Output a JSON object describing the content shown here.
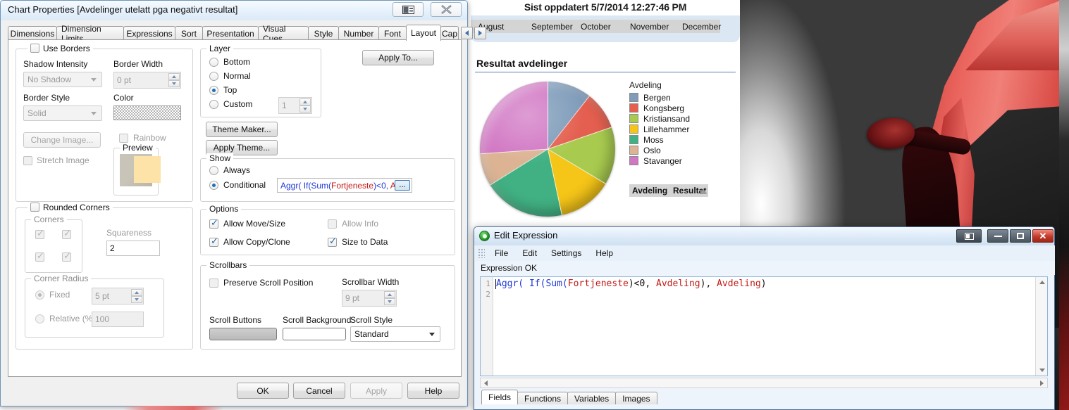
{
  "chart_properties": {
    "title": "Chart Properties [Avdelinger utelatt pga negativt resultat]",
    "titlebar_buttons": {
      "restore_label": "❐",
      "close_label": "✕"
    },
    "tabs": [
      {
        "label": "Dimensions",
        "active": false
      },
      {
        "label": "Dimension Limits",
        "active": false
      },
      {
        "label": "Expressions",
        "active": false
      },
      {
        "label": "Sort",
        "active": false
      },
      {
        "label": "Presentation",
        "active": false
      },
      {
        "label": "Visual Cues",
        "active": false
      },
      {
        "label": "Style",
        "active": false
      },
      {
        "label": "Number",
        "active": false
      },
      {
        "label": "Font",
        "active": false
      },
      {
        "label": "Layout",
        "active": true
      },
      {
        "label": "Cap",
        "active": false
      }
    ],
    "borders_group": {
      "title": "Use Borders",
      "checked": false,
      "shadow_intensity_label": "Shadow Intensity",
      "shadow_intensity_value": "No Shadow",
      "border_width_label": "Border Width",
      "border_width_value": "0 pt",
      "border_style_label": "Border Style",
      "border_style_value": "Solid",
      "color_label": "Color",
      "rainbow_label": "Rainbow",
      "rainbow_checked": false,
      "change_image_label": "Change Image...",
      "stretch_image_label": "Stretch Image",
      "stretch_image_checked": false,
      "preview_label": "Preview"
    },
    "rounded_group": {
      "title": "Rounded Corners",
      "checked": false,
      "corners_label": "Corners",
      "corners_checked": [
        true,
        true,
        true,
        true
      ],
      "squareness_label": "Squareness",
      "squareness_value": "2",
      "corner_radius_label": "Corner Radius",
      "fixed_label": "Fixed",
      "fixed_selected": true,
      "fixed_value": "5 pt",
      "relative_label": "Relative (%)",
      "relative_selected": false,
      "relative_value": "100"
    },
    "layer_group": {
      "title": "Layer",
      "options": [
        {
          "label": "Bottom",
          "selected": false
        },
        {
          "label": "Normal",
          "selected": false
        },
        {
          "label": "Top",
          "selected": true
        },
        {
          "label": "Custom",
          "selected": false
        }
      ],
      "custom_value": "1"
    },
    "apply_to_label": "Apply To...",
    "theme_maker_label": "Theme Maker...",
    "apply_theme_label": "Apply Theme...",
    "show_group": {
      "title": "Show",
      "always_label": "Always",
      "always_selected": false,
      "conditional_label": "Conditional",
      "conditional_selected": true,
      "expression_tokens": [
        {
          "text": "Aggr(",
          "kind": "fn"
        },
        {
          "text": " ",
          "kind": "op"
        },
        {
          "text": "If(",
          "kind": "fn"
        },
        {
          "text": "Sum(",
          "kind": "fn"
        },
        {
          "text": "Fortjeneste",
          "kind": "fld"
        },
        {
          "text": ")<0, ",
          "kind": "fn"
        },
        {
          "text": "Avde",
          "kind": "fld"
        }
      ],
      "ellipsis_button_label": "..."
    },
    "options_group": {
      "title": "Options",
      "items": [
        {
          "label": "Allow Move/Size",
          "checked": true,
          "disabled": false
        },
        {
          "label": "Allow Info",
          "checked": false,
          "disabled": true
        },
        {
          "label": "Allow Copy/Clone",
          "checked": true,
          "disabled": false
        },
        {
          "label": "Size to Data",
          "checked": true,
          "disabled": false
        }
      ]
    },
    "scrollbars_group": {
      "title": "Scrollbars",
      "preserve_label": "Preserve Scroll Position",
      "preserve_checked": false,
      "scrollbar_width_label": "Scrollbar Width",
      "scrollbar_width_value": "9 pt",
      "scroll_buttons_label": "Scroll Buttons",
      "scroll_background_label": "Scroll Background",
      "scroll_style_label": "Scroll Style",
      "scroll_style_value": "Standard"
    },
    "footer_buttons": [
      {
        "label": "OK",
        "disabled": false
      },
      {
        "label": "Cancel",
        "disabled": false
      },
      {
        "label": "Apply",
        "disabled": true
      },
      {
        "label": "Help",
        "disabled": false
      }
    ]
  },
  "qlikview_document": {
    "last_updated": "Sist oppdatert 5/7/2014 12:27:46 PM",
    "month_listbox": [
      "August",
      "September",
      "October",
      "November",
      "December"
    ],
    "chart_title": "Resultat avdelinger",
    "table_headers": [
      "Avdeling",
      "Resultat"
    ]
  },
  "chart_data": {
    "type": "pie",
    "title": "Resultat avdelinger",
    "legend_title": "Avdeling",
    "legend_position": "right",
    "categories": [
      "Bergen",
      "Kongsberg",
      "Kristiansand",
      "Lillehammer",
      "Moss",
      "Oslo",
      "Stavanger"
    ],
    "values": [
      10.6,
      9.2,
      13.9,
      13.1,
      19.4,
      7.8,
      26.0
    ],
    "unit": "percent",
    "angles_deg": [
      38,
      33,
      50,
      47,
      70,
      28,
      94
    ],
    "start_angle_deg": 0,
    "colors": [
      "#7f9cba",
      "#e45f4f",
      "#a8cb4f",
      "#f5c518",
      "#41b183",
      "#dcb393",
      "#d176c3"
    ]
  },
  "edit_expression": {
    "title": "Edit Expression",
    "titlebar_buttons": {
      "restore_label": "restore",
      "minimize_label": "minimize",
      "maximize_label": "maximize",
      "close_label": "close"
    },
    "menus": [
      "File",
      "Edit",
      "Settings",
      "Help"
    ],
    "status": "Expression OK",
    "line_numbers": [
      "1",
      "2"
    ],
    "expression_tokens": [
      {
        "text": "Aggr(",
        "kind": "fn"
      },
      {
        "text": " ",
        "kind": "op"
      },
      {
        "text": "If(",
        "kind": "fn"
      },
      {
        "text": "Sum(",
        "kind": "fn"
      },
      {
        "text": "Fortjeneste",
        "kind": "fld"
      },
      {
        "text": ")<0, ",
        "kind": "op"
      },
      {
        "text": "Avdeling",
        "kind": "fld"
      },
      {
        "text": "), ",
        "kind": "op"
      },
      {
        "text": "Avdeling",
        "kind": "fld"
      },
      {
        "text": ")",
        "kind": "op"
      }
    ],
    "tabs": [
      {
        "label": "Fields",
        "active": true
      },
      {
        "label": "Functions",
        "active": false
      },
      {
        "label": "Variables",
        "active": false
      },
      {
        "label": "Images",
        "active": false
      }
    ]
  }
}
